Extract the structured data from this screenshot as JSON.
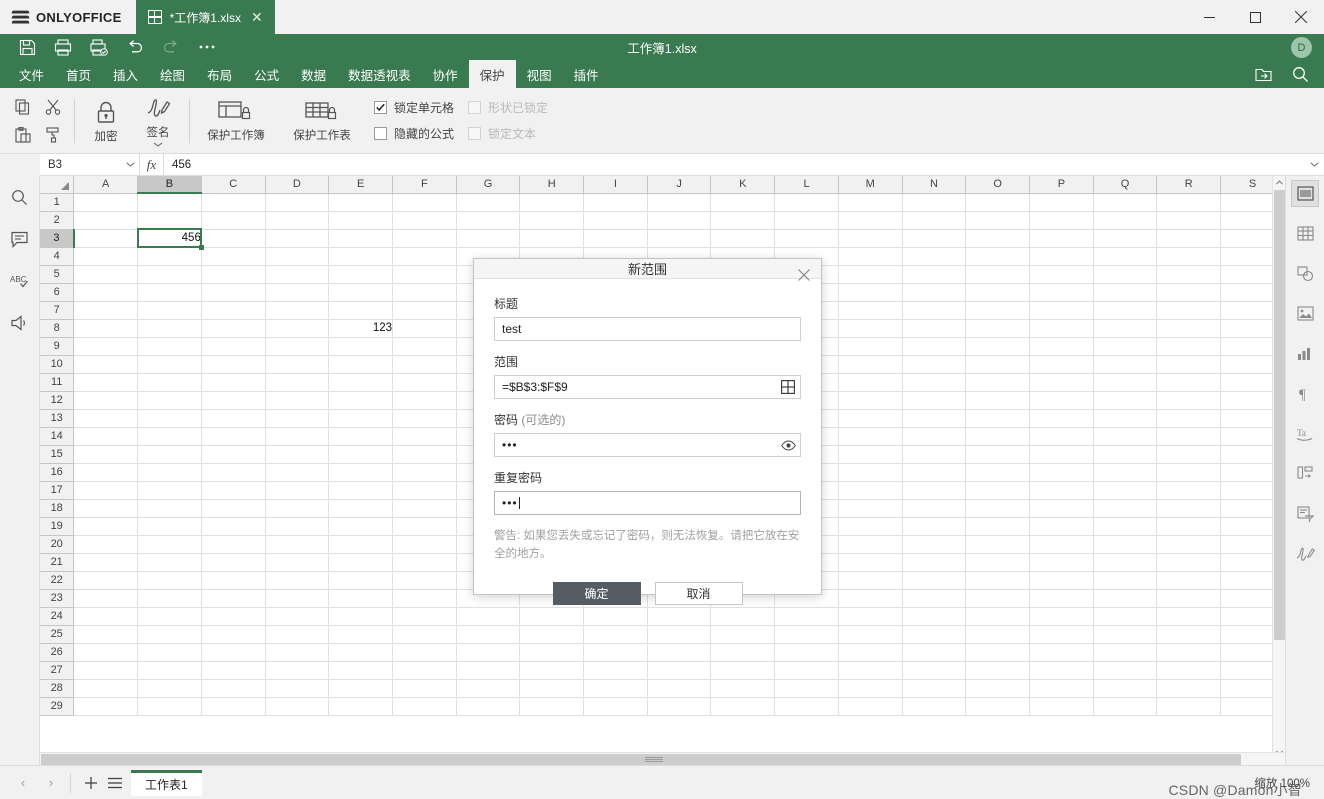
{
  "app": {
    "brand": "ONLYOFFICE",
    "document_title": "工作簿1.xlsx",
    "tab_title": "*工作簿1.xlsx",
    "avatar_initial": "D"
  },
  "window_controls": {
    "minimize": "minimize-icon",
    "maximize": "maximize-icon",
    "close": "close-icon"
  },
  "quick_access": [
    {
      "name": "save-icon",
      "title": "保存"
    },
    {
      "name": "print-icon",
      "title": "打印"
    },
    {
      "name": "quick-print-icon",
      "title": "快速打印"
    },
    {
      "name": "undo-icon",
      "title": "撤销"
    },
    {
      "name": "redo-icon",
      "title": "重做"
    },
    {
      "name": "more-icon",
      "title": "更多"
    }
  ],
  "menu": {
    "items": [
      {
        "label": "文件",
        "active": false
      },
      {
        "label": "首页",
        "active": false
      },
      {
        "label": "插入",
        "active": false
      },
      {
        "label": "绘图",
        "active": false
      },
      {
        "label": "布局",
        "active": false
      },
      {
        "label": "公式",
        "active": false
      },
      {
        "label": "数据",
        "active": false
      },
      {
        "label": "数据透视表",
        "active": false
      },
      {
        "label": "协作",
        "active": false
      },
      {
        "label": "保护",
        "active": true
      },
      {
        "label": "视图",
        "active": false
      },
      {
        "label": "插件",
        "active": false
      }
    ]
  },
  "ribbon": {
    "copy_label": "复制",
    "cut_label": "剪切",
    "paste_label": "粘贴",
    "format_painter_label": "格式刷",
    "encrypt_label": "加密",
    "signature_label": "签名",
    "protect_workbook_label": "保护工作簿",
    "protect_sheet_label": "保护工作表",
    "checkboxes": [
      {
        "label": "锁定单元格",
        "checked": true,
        "disabled": false
      },
      {
        "label": "形状已锁定",
        "checked": false,
        "disabled": true
      },
      {
        "label": "隐藏的公式",
        "checked": false,
        "disabled": false
      },
      {
        "label": "锁定文本",
        "checked": false,
        "disabled": true
      }
    ]
  },
  "formula_bar": {
    "name_box": "B3",
    "fx_label": "fx",
    "formula_value": "456"
  },
  "left_sidebar": [
    {
      "name": "search-icon"
    },
    {
      "name": "comment-icon"
    },
    {
      "name": "spellcheck-icon"
    },
    {
      "name": "feedback-icon"
    }
  ],
  "right_sidebar": [
    {
      "name": "cell-settings-icon",
      "active": true
    },
    {
      "name": "table-settings-icon",
      "active": false
    },
    {
      "name": "shape-settings-icon",
      "active": false
    },
    {
      "name": "image-settings-icon",
      "active": false
    },
    {
      "name": "chart-settings-icon",
      "active": false
    },
    {
      "name": "paragraph-settings-icon",
      "active": false
    },
    {
      "name": "text-art-settings-icon",
      "active": false
    },
    {
      "name": "slicer-settings-icon",
      "active": false
    },
    {
      "name": "pivot-settings-icon",
      "active": false
    },
    {
      "name": "signature-settings-icon",
      "active": false
    }
  ],
  "grid": {
    "columns": [
      "A",
      "B",
      "C",
      "D",
      "E",
      "F",
      "G",
      "H",
      "I",
      "J",
      "K",
      "L",
      "M",
      "N",
      "O",
      "P",
      "Q",
      "R",
      "S"
    ],
    "selected_column": "B",
    "selected_row": 3,
    "rows": [
      1,
      2,
      3,
      4,
      5,
      6,
      7,
      8,
      9,
      10,
      11,
      12,
      13,
      14,
      15,
      16,
      17,
      18,
      19,
      20,
      21,
      22,
      23,
      24,
      25,
      26,
      27,
      28,
      29
    ],
    "cells": [
      {
        "col": "B",
        "row": 3,
        "value": "456",
        "selected": true
      },
      {
        "col": "E",
        "row": 8,
        "value": "123",
        "selected": false
      }
    ]
  },
  "dialog": {
    "title": "新范围",
    "close_icon": "close-icon",
    "fields": {
      "title_label": "标题",
      "title_value": "test",
      "range_label": "范围",
      "range_value": "=$B$3:$F$9",
      "range_picker_icon": "select-range-icon",
      "password_label": "密码",
      "password_label_optional": "(可选的)",
      "password_value": "•••",
      "password_reveal_icon": "eye-icon",
      "repeat_password_label": "重复密码",
      "repeat_password_value": "•••"
    },
    "warning": "警告: 如果您丢失或忘记了密码，则无法恢复。请把它放在安全的地方。",
    "ok_label": "确定",
    "cancel_label": "取消"
  },
  "status_bar": {
    "prev_sheet_icon": "chevron-left-icon",
    "next_sheet_icon": "chevron-right-icon",
    "add_sheet_icon": "plus-icon",
    "sheet_list_icon": "list-icon",
    "sheet_tab": "工作表1",
    "zoom_label": "缩放 100%",
    "watermark": "CSDN @Damon小智"
  }
}
